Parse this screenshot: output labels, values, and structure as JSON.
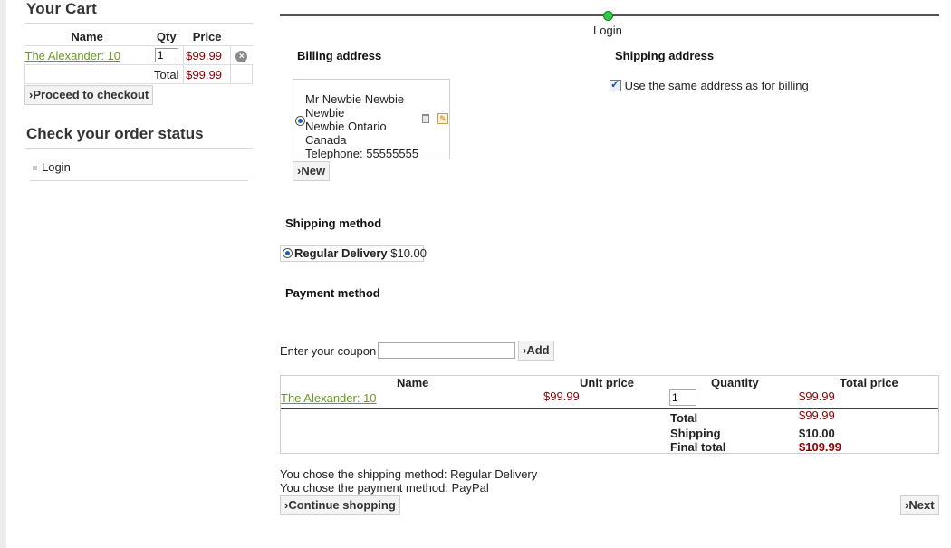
{
  "cart": {
    "title": "Your Cart",
    "headers": {
      "name": "Name",
      "qty": "Qty",
      "price": "Price"
    },
    "item": {
      "name": "The Alexander: 10",
      "qty": "1",
      "price": "$99.99"
    },
    "total_label": "Total",
    "total_value": "$99.99",
    "checkout_button": "Proceed to checkout"
  },
  "order_status": {
    "title": "Check your order status",
    "login_link": "Login"
  },
  "progress": {
    "step_label": "Login"
  },
  "billing": {
    "title": "Billing address",
    "address_lines": [
      "Mr Newbie Newbie",
      "Newbie",
      "Newbie Ontario",
      "Canada",
      "Telephone: 55555555"
    ],
    "new_button": "New"
  },
  "shipping": {
    "title": "Shipping address",
    "same_address_label": "Use the same address as for billing",
    "same_address_checked": true
  },
  "shipping_method": {
    "title": "Shipping method",
    "option_name": "Regular Delivery",
    "option_price": "$10.00"
  },
  "payment_method": {
    "title": "Payment method"
  },
  "coupon": {
    "label": "Enter your coupon",
    "value": "",
    "add_button": "Add"
  },
  "order": {
    "headers": {
      "name": "Name",
      "unit_price": "Unit price",
      "quantity": "Quantity",
      "total_price": "Total price"
    },
    "item": {
      "name": "The Alexander: 10",
      "unit_price": "$99.99",
      "quantity": "1",
      "total_price": "$99.99"
    },
    "summary": [
      {
        "label": "Total",
        "value": "$99.99"
      },
      {
        "label": "Shipping",
        "value": "$10.00"
      },
      {
        "label": "Final total",
        "value": "$109.99"
      }
    ]
  },
  "chosen": {
    "shipping_text": "You chose the shipping method: Regular Delivery",
    "payment_text": "You chose the payment method: PayPal"
  },
  "nav": {
    "continue_button": "Continue shopping",
    "next_button": "Next"
  },
  "colors": {
    "link_green": "#6a9a1f",
    "price_red": "#8b0000",
    "progress_green": "#2ecc40"
  },
  "icons": {
    "remove": "remove-circle-icon",
    "trash": "trash-icon",
    "edit": "edit-icon",
    "bullet": "bullet-icon"
  }
}
